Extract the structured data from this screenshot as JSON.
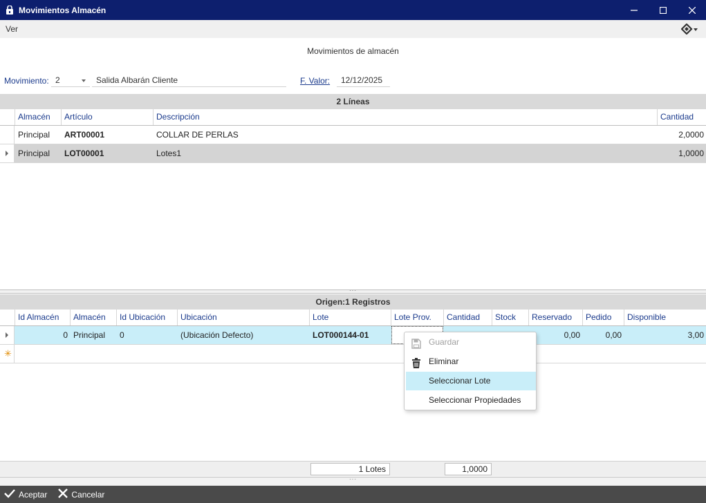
{
  "window": {
    "title": "Movimientos Almacén"
  },
  "menu": {
    "ver": "Ver"
  },
  "heading": "Movimientos de almacén",
  "form": {
    "movimiento_label": "Movimiento:",
    "movimiento_value": "2",
    "movimiento_desc": "Salida Albarán Cliente",
    "fvalor_label": "F. Valor:",
    "fvalor_value": "12/12/2025"
  },
  "lines": {
    "band": "2 Líneas",
    "headers": [
      "Almacén",
      "Artículo",
      "Descripción",
      "Cantidad"
    ],
    "rows": [
      {
        "almacen": "Principal",
        "articulo": "ART00001",
        "descripcion": "COLLAR DE PERLAS",
        "cantidad": "2,0000"
      },
      {
        "almacen": "Principal",
        "articulo": "LOT00001",
        "descripcion": "Lotes1",
        "cantidad": "1,0000"
      }
    ]
  },
  "origen": {
    "band": "Origen:1 Registros",
    "headers": [
      "Id Almacén",
      "Almacén",
      "Id Ubicación",
      "Ubicación",
      "Lote",
      "Lote Prov.",
      "Cantidad",
      "Stock",
      "Reservado",
      "Pedido",
      "Disponible"
    ],
    "rows": [
      {
        "id_almacen": "0",
        "almacen": "Principal",
        "id_ubicacion": "0",
        "ubicacion": "(Ubicación Defecto)",
        "lote": "LOT000144-01",
        "lote_prov": "",
        "cantidad": "",
        "stock": "",
        "reservado": "0,00",
        "pedido": "0,00",
        "disponible": "3,00"
      }
    ]
  },
  "context_menu": {
    "items": [
      {
        "label": "Guardar",
        "icon": "save-icon",
        "disabled": true
      },
      {
        "label": "Eliminar",
        "icon": "trash-icon",
        "disabled": false
      },
      {
        "label": "Seleccionar Lote",
        "icon": "",
        "disabled": false,
        "highlighted": true
      },
      {
        "label": "Seleccionar Propiedades",
        "icon": "",
        "disabled": false
      }
    ]
  },
  "totals": {
    "lotes": "1 Lotes",
    "cantidad": "1,0000"
  },
  "buttons": {
    "aceptar": "Aceptar",
    "cancelar": "Cancelar"
  },
  "colors": {
    "titlebar": "#0d1f6e",
    "header_text": "#1a3a8c",
    "selected_row": "#c9eef9",
    "bottombar": "#4a4a4a",
    "band": "#d9d9d9"
  }
}
